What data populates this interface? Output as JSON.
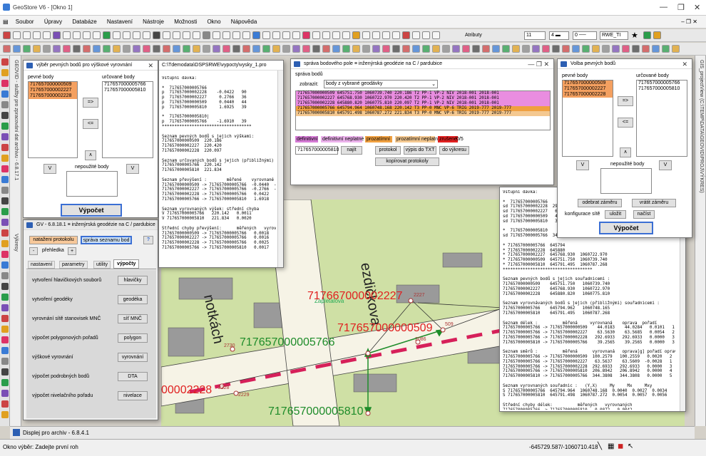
{
  "app": {
    "title": "GeoStore V6 - [Okno 1]",
    "window_controls": [
      "—",
      "❐",
      "✕"
    ]
  },
  "menu": [
    "Soubor",
    "Úpravy",
    "Databáze",
    "Nastavení",
    "Nástroje",
    "Možnosti",
    "Okno",
    "Nápověda"
  ],
  "toolbar": {
    "attributes_label": "Atributy",
    "layer_value": "11",
    "style_value": "RWE_TI"
  },
  "side_panels": {
    "left_panel": "GEOVID - služby pro zpracování dat archivu - 6.8.17.1",
    "left_panel2": "Výkresy",
    "right_panel": "GIS_projectView (C:\\TEMP\\DATA\\GEOVID\\PROJ\\VÝKRES)"
  },
  "map": {
    "street_labels": [
      "ezdičkova",
      "notkách",
      "Zapletalova"
    ],
    "point_labels": {
      "p2227": "717667000002227",
      "p509": "717657000000509",
      "p5766": "717657000005766",
      "p2228": "00002228",
      "p5810": "717657000005810"
    },
    "point_numbers": {
      "n2227": "2227",
      "n509": "509",
      "n2086": "2086",
      "n2730": "2730",
      "n2228": "2228",
      "n2229": "2229"
    }
  },
  "dlg_vyskove": {
    "title": "výběr pevných bodů pro výškové vyrovnání",
    "fixed_label": "pevné body",
    "fixed": [
      "717657000000509",
      "717657000002227",
      "717657000002228"
    ],
    "determined_label": "určované body",
    "determined": [
      "717657000005766",
      "717657000005810"
    ],
    "btn_right": "=>",
    "btn_left": "<=",
    "btn_up": "∧",
    "btn_v1": "V",
    "btn_v2": "V",
    "unused_label": "nepoužité body",
    "compute": "Výpočet"
  },
  "dlg_gv": {
    "title": "GV - 6.8.18.1 ≡ inženýrská geodézie na C / pardubice",
    "btn_protocol": "nataženi protokolu",
    "btn_manage": "správa  seznamu bod",
    "btn_help": "?",
    "btn_minus": "-",
    "overview": "přehledka",
    "btn_plus": "+",
    "tabs": [
      "nastavení",
      "parametry",
      "utility",
      "výpočty"
    ],
    "rows": [
      {
        "label": "vytvoření hlavičkových souborů",
        "button": "hlavičky"
      },
      {
        "label": "vytvoření geodéky",
        "button": "geodéka"
      },
      {
        "label": "vyrovnání sítě stanovisek MNČ",
        "button": "síť MNČ"
      },
      {
        "label": "výpočet polygonových pořadů",
        "button": "polygon"
      },
      {
        "label": "výškové vyrovnání",
        "button": "vyrovnání"
      },
      {
        "label": "výpočet podrobných bodů",
        "button": "DTA"
      },
      {
        "label": "výpočet nivelačního pořadu",
        "button": "nivelace"
      }
    ]
  },
  "win_vysky": {
    "title": "C:\\Tdemodata\\DSPSRWE\\vypocty\\vysky_1.pro",
    "text": "Vstupní dávka:\n\n*  717657000005766\np  717657000002228    -0.0422   90\np  717657000002227     0.2766   36\np  717657000000509     0.0440   44\np  717657000005810     1.6925   39\n\n*  717657000005810|\np  717657000005766    -1.6910   39\n************************************\n\nSeznam pevných bodů s jejich výškami:\n717657000000509  220.186\n717657000002227  220.420\n717657000002228  220.097\n\nSeznam určovaných bodů s jejich (přibližnými) výškami:\n717657000005766  220.142\n717657000005810  221.834\n\nSeznam převýšení :        měřené    vyrovnané   oprava  pořadí\n717657000000509 -> 717657000005766  -0.0440  -0.0439  0.0001  3\n717657000002227 -> 717657000005766  -0.2766  -0.2779 -0.0013  2\n717657000002228 -> 717657000005766   0.0422   0.0451  0.0029  1\n717657000005766 -> 717657000005810   1.6918   1.6918  0.0000  4\n\nSeznam vyrovnaných výšek: střední chyba\nV 717657000005766   220.142   0.0011\nV 717657000005810   221.834   0.0020\n\nStřední chyby převýšení:      měřených   vyrovnaných\n717657000000509 -> 717657000005766   0.0018   0.0011\n717657000002227 -> 717657000005766   0.0016   0.0011\n717657000002228 -> 717657000005766   0.0025   0.0011\n717657000005766 -> 717657000005810   0.0017   0.0017"
  },
  "dlg_sprava": {
    "title": "správa bodového pole ≡ inženýrská geodézie na C / pardubice",
    "section": "správa bodů",
    "show_label": "zobrazit:",
    "show_value": "body z vybrané geodávky",
    "rows": [
      {
        "text": "717657000000509  645751.750  1060739.740   220.186  T2  PP-1          VP-2    NIV    2018-001  2018-001",
        "color": "#e98de0"
      },
      {
        "text": "717657000002227  645768.930  1060722.970   220.420  T2  PP-1          VP-2    NIV    2018-001  2018-001",
        "color": "#e98de0"
      },
      {
        "text": "717657000002228  645880.820  1060775.810   220.097  T2  PP-1          VP-2    NIV    2018-001  2018-001",
        "color": "#e98de0"
      },
      {
        "text": "717657000005766  645794.964  1060748.168   220.142  T3  PP-0    MNC   VP-6    TRIG   2019-777  2019-777",
        "color": "#f0a040"
      },
      {
        "text": "717657000005810  645791.498  1060787.272   221.834  T3  PP-0    MNC   VP-6    TRIG   2019-777  2019-777",
        "color": "#f4c890"
      }
    ],
    "legend": [
      {
        "label": "definitivní",
        "color": "#d47ad4"
      },
      {
        "label": "definitivní neplatné",
        "color": "#eab0ea"
      },
      {
        "label": "prozatímní",
        "color": "#f0a040"
      },
      {
        "label": "prozatímní neplatné",
        "color": "#f4c890"
      },
      {
        "label": "zrušené",
        "color": "#e02020"
      }
    ],
    "count": "0/5",
    "search_value": "717657000005810",
    "btn_find": "najít",
    "btn_protocol": "protokol",
    "btn_txt": "výpis do TXT",
    "btn_drawing": "do výkresu",
    "btn_copy": "kopírovat protokoly"
  },
  "dlg_volba": {
    "title": "Volba pevných bodů",
    "fixed_label": "pevné body",
    "fixed": [
      "717657000000509",
      "717657000002227",
      "717657000002228"
    ],
    "determined_label": "určované body",
    "determined": [
      "717657000005766",
      "717657000005810"
    ],
    "btn_right": "=>",
    "btn_left": "<=",
    "btn_up": "∧",
    "btn_v1": "V",
    "btn_v2": "V",
    "unused_label": "nepoužité body",
    "btn_remove": "odebrat záměru",
    "btn_return": "vrátit záměru",
    "config_label": "konfigurace sítě",
    "btn_save": "uložit",
    "btn_load": "načíst",
    "compute": "Výpočet"
  },
  "win_protocol": {
    "text": "Vstupní dávka:\n\n*  717657000005766\nsd 717657000002228  292.\nsd 717657000002227   63.5\nsd 717657000000509   44.0\nsd 717657000005810   39.2\n\n*  717657000005810\nsd 717657000005766  344.\n\n* 717657000005766  645794\n* 717657000002228  645880\n* 717657000002227  645768.930  1060722.970\n* 717657000000509  645751.750  1060739.740\n* 717657000005810  645791.495  1060787.268\n************************************\n\nSeznam pevných bodů s jejich souřadnicemi :\n717657000000509    645751.750   1060739.740\n717657000002227    645768.930   1060722.970\n717657000002228    645880.820   1060775.810\n\nSeznam vyrovnávaných bodů s jejich (přibližnými) souřadnicemi :\n717657000005766    645794.962   1060748.165\n717657000005810    645791.495   1060787.268\n\nSeznam délek :          měřená     vyrovnaná    oprava  pořadí\n717657000005766 -> 717657000000509    44.0183    44.0284   0.0101   1\n717657000005766 -> 717657000002227    63.5630    63.5685   0.0054   2\n717657000005766 -> 717657000002228   292.6933   292.6933   0.0000   3\n717657000005810 -> 717657000005766    39.2565    39.2565   0.0000   3\n\nSeznam směrů :          měřená      vyrovnaná   oprava[g] pořadí oprava[m]\n717657000005766 -> 717657000000509  100.2579   100.2559   0.0020   2  0.0014\n717657000005766 -> 717657000002227   63.5637    63.5609  -0.0028   1  0.0016\n717657000005766 -> 717657000002228  292.6933   292.6933   0.0000   3  0.0001\n717657000005766 -> 717657000005810  206.8942   206.8942   0.0000   4  0.0000\n717657000005810 -> 717657000005766  344.3808   344.3808   0.0000   5  0.0000\n\nSeznam vyrovnaných souřadnic :   (Y,X)     My     Mx     Mxy\nS 717657000005766  645794.964  1060748.168  0.0040  0.0027  0.0034\nS 717657000005810  645791.498  1060787.272  0.0054  0.0057  0.0056\n\nStřední chyby délek:          měřených   vyrovnaných\n717657000005766 -> 717657000005810   0.0072   0.0042"
  },
  "bottom": {
    "tab_label": "Displej pro archiv - 6.8.4.1",
    "status_left": "Okno výběr: Zadejte první roh",
    "coords": "-645729.587/-1060710.418"
  }
}
